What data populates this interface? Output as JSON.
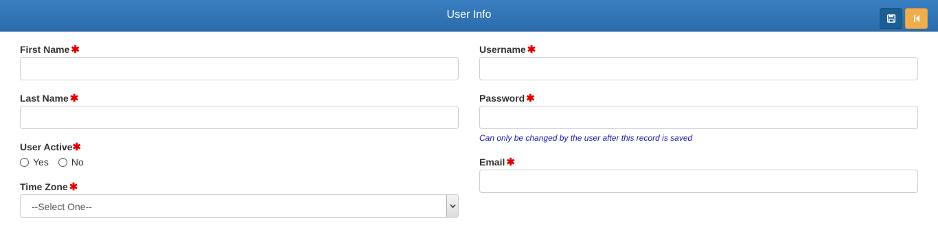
{
  "header": {
    "title": "User Info",
    "save_icon": "save-icon",
    "back_icon": "skip-back-icon"
  },
  "form": {
    "first_name": {
      "label": "First Name",
      "value": ""
    },
    "last_name": {
      "label": "Last Name",
      "value": ""
    },
    "user_active": {
      "label": "User Active",
      "options": [
        "Yes",
        "No"
      ],
      "selected": null
    },
    "time_zone": {
      "label": "Time Zone",
      "selected": "--Select One--"
    },
    "username": {
      "label": "Username",
      "value": ""
    },
    "password": {
      "label": "Password",
      "value": "",
      "hint": "Can only be changed by the user after this record is saved"
    },
    "email": {
      "label": "Email",
      "value": ""
    },
    "required_mark": "✱"
  },
  "colors": {
    "header": "#2f74b5",
    "save_button": "#1b5f92",
    "back_button": "#f0ad4e",
    "required": "#e00000",
    "hint": "#1a1aa6"
  }
}
